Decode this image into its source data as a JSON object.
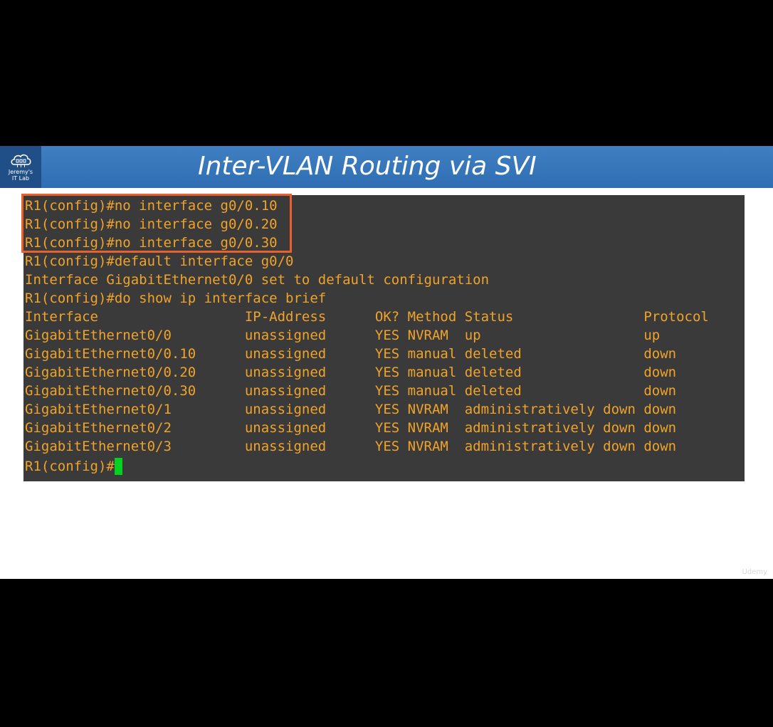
{
  "slide": {
    "title": "Inter-VLAN Routing via SVI",
    "logo": {
      "line1": "Jeremy's",
      "line2": "IT Lab",
      "icon": "cloud-network-icon"
    },
    "watermark": "Udemy"
  },
  "terminal": {
    "lines": [
      "R1(config)#no interface g0/0.10",
      "R1(config)#no interface g0/0.20",
      "R1(config)#no interface g0/0.30",
      "R1(config)#default interface g0/0",
      "Interface GigabitEthernet0/0 set to default configuration",
      "R1(config)#do show ip interface brief",
      "Interface                  IP-Address      OK? Method Status                Protocol",
      "GigabitEthernet0/0         unassigned      YES NVRAM  up                    up",
      "GigabitEthernet0/0.10      unassigned      YES manual deleted               down",
      "GigabitEthernet0/0.20      unassigned      YES manual deleted               down",
      "GigabitEthernet0/0.30      unassigned      YES manual deleted               down",
      "GigabitEthernet0/1         unassigned      YES NVRAM  administratively down down",
      "GigabitEthernet0/2         unassigned      YES NVRAM  administratively down down",
      "GigabitEthernet0/3         unassigned      YES NVRAM  administratively down down"
    ],
    "prompt": "R1(config)#",
    "colors": {
      "text": "#f0a32a",
      "background": "#3a3a3a",
      "cursor": "#00d21f",
      "highlight": "#e8602c"
    }
  }
}
